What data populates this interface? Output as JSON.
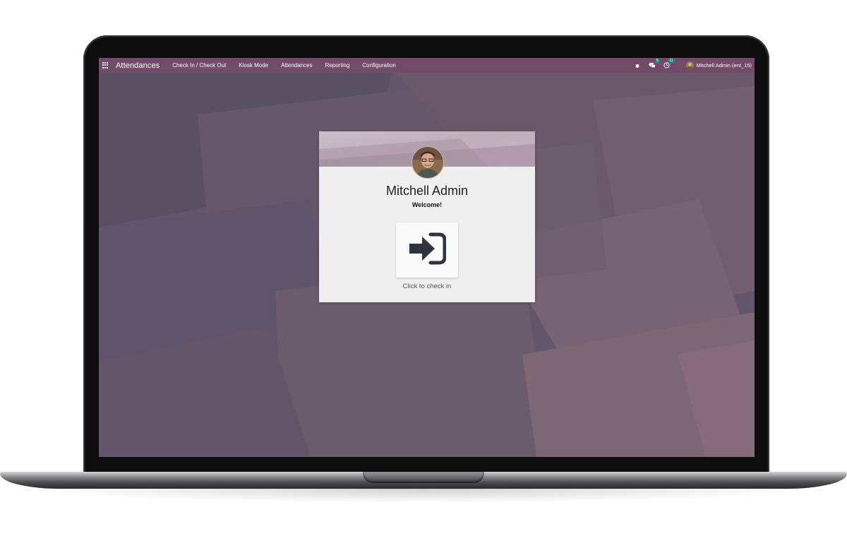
{
  "navbar": {
    "app_title": "Attendances",
    "menu": [
      "Check In / Check Out",
      "Kiosk Mode",
      "Attendances",
      "Reporting",
      "Configuration"
    ],
    "messages_badge": "5",
    "activities_badge": "11",
    "user_label": "Mitchell Admin (ent_15)",
    "color": "#714b67"
  },
  "card": {
    "employee_name": "Mitchell Admin",
    "greeting": "Welcome!",
    "action_caption": "Click to check in",
    "action_icon": "sign-in-icon"
  }
}
